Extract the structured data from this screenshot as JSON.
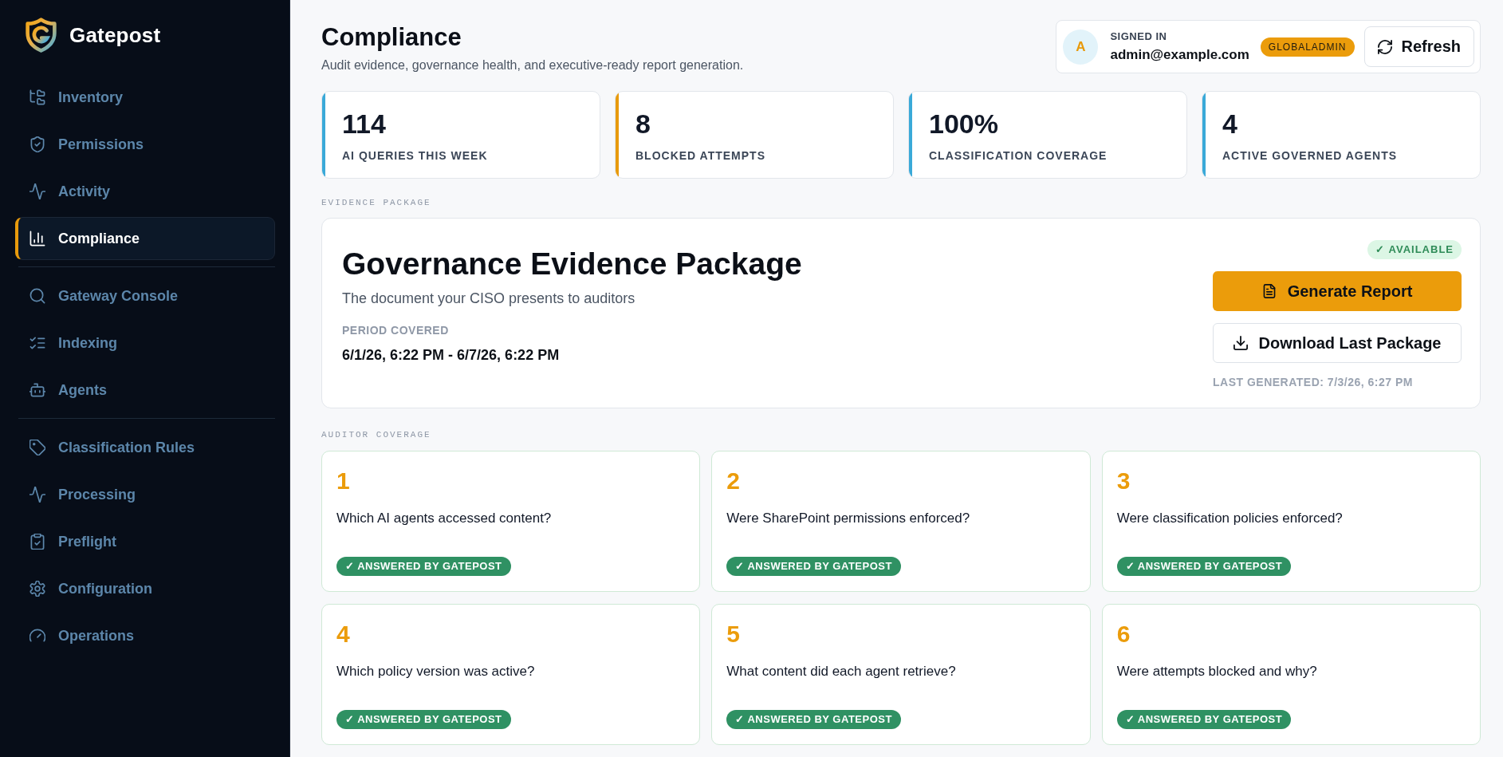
{
  "sidebar": {
    "brand": "Gatepost",
    "nav_groups": [
      {
        "items": [
          {
            "label": "Inventory",
            "selected": false
          },
          {
            "label": "Permissions",
            "selected": false
          },
          {
            "label": "Activity",
            "selected": false
          },
          {
            "label": "Compliance",
            "selected": true
          }
        ]
      },
      {
        "items": [
          {
            "label": "Gateway Console",
            "selected": false
          },
          {
            "label": "Indexing",
            "selected": false
          },
          {
            "label": "Agents",
            "selected": false
          }
        ]
      },
      {
        "items": [
          {
            "label": "Classification Rules",
            "selected": false
          },
          {
            "label": "Processing",
            "selected": false
          },
          {
            "label": "Preflight",
            "selected": false
          },
          {
            "label": "Configuration",
            "selected": false
          },
          {
            "label": "Operations",
            "selected": false
          }
        ]
      }
    ]
  },
  "header": {
    "title": "Compliance",
    "subtitle": "Audit evidence, governance health, and executive-ready report generation.",
    "user": {
      "avatar": "A",
      "caption": "SIGNED IN",
      "email": "admin@example.com",
      "role": "GLOBALADMIN"
    },
    "refresh_button": "Refresh"
  },
  "stats": [
    {
      "value": "114",
      "label": "AI QUERIES THIS WEEK",
      "color": "#3aa9d8"
    },
    {
      "value": "8",
      "label": "BLOCKED ATTEMPTS",
      "color": "#e89a0c"
    },
    {
      "value": "100%",
      "label": "CLASSIFICATION COVERAGE",
      "color": "#3aa9d8"
    },
    {
      "value": "4",
      "label": "ACTIVE GOVERNED AGENTS",
      "color": "#3aa9d8"
    }
  ],
  "evidence_package": {
    "section_label": "EVIDENCE PACKAGE",
    "title": "Governance Evidence Package",
    "subtitle": "The document your CISO presents to auditors",
    "period_label": "PERIOD COVERED",
    "period": "6/1/26, 6:22 PM - 6/7/26, 6:22 PM",
    "status": "✓ AVAILABLE",
    "generate_button": "Generate Report",
    "download_button": "Download Last Package",
    "last_generated": "LAST GENERATED: 7/3/26, 6:27 PM"
  },
  "auditor_coverage": {
    "section_label": "AUDITOR COVERAGE",
    "questions": [
      {
        "number": "1",
        "question": "Which AI agents accessed content?",
        "badge": "✓ ANSWERED BY GATEPOST"
      },
      {
        "number": "2",
        "question": "Were SharePoint permissions enforced?",
        "badge": "✓ ANSWERED BY GATEPOST"
      },
      {
        "number": "3",
        "question": "Were classification policies enforced?",
        "badge": "✓ ANSWERED BY GATEPOST"
      },
      {
        "number": "4",
        "question": "Which policy version was active?",
        "badge": "✓ ANSWERED BY GATEPOST"
      },
      {
        "number": "5",
        "question": "What content did each agent retrieve?",
        "badge": "✓ ANSWERED BY GATEPOST"
      },
      {
        "number": "6",
        "question": "Were attempts blocked and why?",
        "badge": "✓ ANSWERED BY GATEPOST"
      }
    ]
  }
}
